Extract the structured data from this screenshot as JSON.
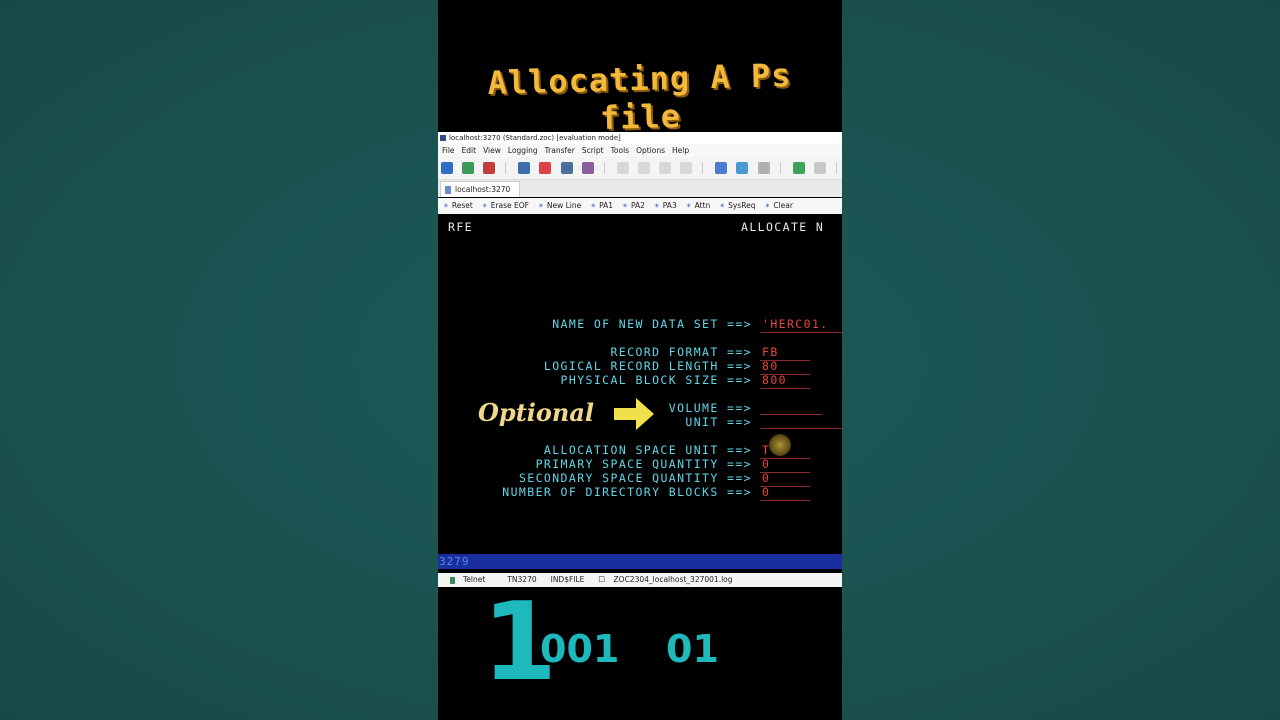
{
  "banner": {
    "title": "Allocating A Ps file"
  },
  "window": {
    "title": "localhost:3270 (Standard.zoc) [evaluation mode]",
    "menu": [
      "File",
      "Edit",
      "View",
      "Logging",
      "Transfer",
      "Script",
      "Tools",
      "Options",
      "Help"
    ],
    "tab": "localhost:3270",
    "buttons": [
      "Reset",
      "Erase EOF",
      "New Line",
      "PA1",
      "PA2",
      "PA3",
      "Attn",
      "SysReq",
      "Clear"
    ]
  },
  "terminal": {
    "header_left": "RFE",
    "header_right": "ALLOCATE N",
    "fields": {
      "dsname_label": "NAME OF NEW DATA SET ==>",
      "dsname_value": "'HERC01.",
      "recfm_label": "RECORD FORMAT ==>",
      "recfm_value": "FB",
      "lrecl_label": "LOGICAL RECORD LENGTH ==>",
      "lrecl_value": "80",
      "blksize_label": "PHYSICAL BLOCK SIZE ==>",
      "blksize_value": "800",
      "volume_label": "VOLUME ==>",
      "unit_label": "UNIT ==>",
      "spaceunit_label": "ALLOCATION SPACE UNIT ==>",
      "spaceunit_value": "T",
      "primary_label": "PRIMARY SPACE QUANTITY ==>",
      "primary_value": "0",
      "secondary_label": "SECONDARY SPACE QUANTITY ==>",
      "secondary_value": "0",
      "dirblocks_label": "NUMBER OF DIRECTORY BLOCKS ==>",
      "dirblocks_value": "0"
    },
    "annotation": "Optional",
    "status_line": "3279"
  },
  "statusbar": {
    "items": [
      "Telnet",
      "TN3270",
      "IND$FILE",
      "ZOC2304_localhost_327001.log"
    ]
  },
  "counter": {
    "big": "1",
    "a": "001",
    "b": "01"
  },
  "colors": {
    "field_label": "#5fd7e8",
    "field_value": "#e8453c",
    "accent": "#f3b93a",
    "counter": "#1eb9bc"
  }
}
